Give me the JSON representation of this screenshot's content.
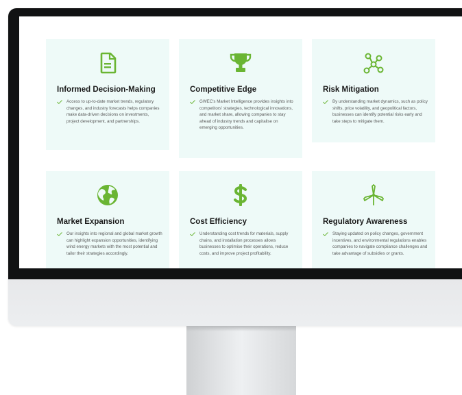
{
  "colors": {
    "accent": "#6ab533",
    "card_bg": "#eefaf8",
    "title": "#1a1a1a",
    "body": "#5a5a5a"
  },
  "cards": [
    {
      "icon": "document-icon",
      "title": "Informed Decision-Making",
      "text": "Access to up-to-date market trends, regulatory changes, and industry forecasts helps companies make data-driven decisions on investments, project development, and partnerships."
    },
    {
      "icon": "trophy-icon",
      "title": "Competitive Edge",
      "text": "GWEC's Market Intelligence provides insights into competitors' strategies, technological innovations, and market share, allowing companies to stay ahead of industry trends and capitalise on emerging opportunities."
    },
    {
      "icon": "network-nodes-icon",
      "title": "Risk Mitigation",
      "text": "By understanding market dynamics, such as policy shifts, price volatility, and geopolitical factors, businesses can identify potential risks early and take steps to mitigate them."
    },
    {
      "icon": "globe-icon",
      "title": "Market Expansion",
      "text": "Our insights into regional and global market growth can highlight expansion opportunities, identifying wind energy markets with the most potential and tailor their strategies accordingly."
    },
    {
      "icon": "dollar-icon",
      "title": "Cost Efficiency",
      "text": "Understanding cost trends for materials, supply chains, and installation processes allows businesses to optimise their operations, reduce costs, and improve project profitability."
    },
    {
      "icon": "wind-turbine-icon",
      "title": "Regulatory Awareness",
      "text": "Staying updated on policy changes, government incentives, and environmental regulations enables companies to navigate compliance challenges and take advantage of subsidies or grants."
    }
  ]
}
